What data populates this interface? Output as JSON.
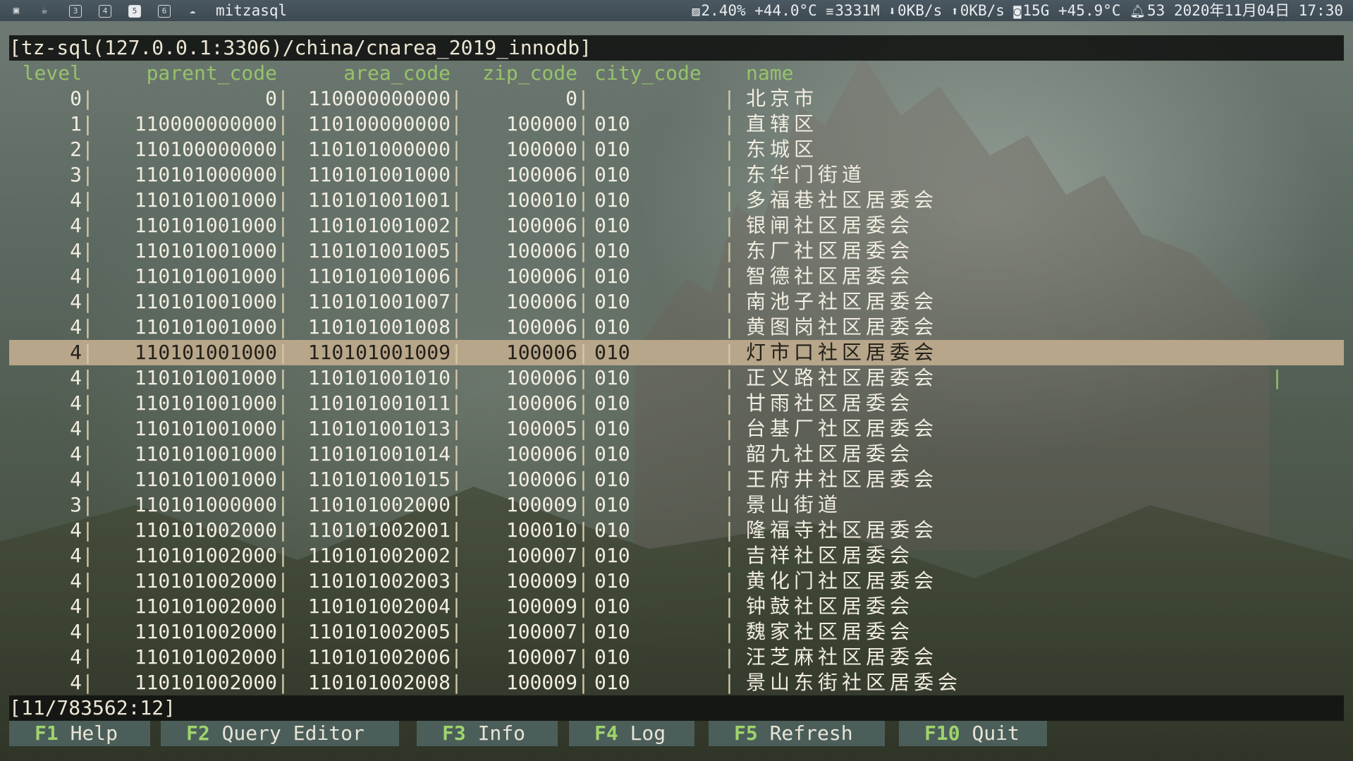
{
  "topbar": {
    "workspaces": [
      {
        "icon": "terminal-icon",
        "glyph": "▣"
      },
      {
        "icon": "coffee-icon",
        "glyph": "☕"
      },
      {
        "label": "3"
      },
      {
        "label": "4"
      },
      {
        "label": "5",
        "active": true
      },
      {
        "label": "6"
      },
      {
        "icon": "cloud-icon",
        "glyph": "☁"
      }
    ],
    "window_title": "mitzasql",
    "cpu": "2.40% +44.0°C",
    "mem": "3331M",
    "net_down": "0KB/s",
    "net_up": "0KB/s",
    "disk": "15G +45.9°C",
    "notifications": "53",
    "datetime": "2020年11月04日 17:30"
  },
  "terminal": {
    "title": "[tz-sql(127.0.0.1:3306)/china/cnarea_2019_innodb]",
    "columns": [
      "level",
      "parent_code",
      "area_code",
      "zip_code",
      "city_code",
      "name"
    ],
    "rows": [
      [
        "0",
        "0",
        "110000000000",
        "0",
        "",
        "北京市"
      ],
      [
        "1",
        "110000000000",
        "110100000000",
        "100000",
        "010",
        "直辖区"
      ],
      [
        "2",
        "110100000000",
        "110101000000",
        "100000",
        "010",
        "东城区"
      ],
      [
        "3",
        "110101000000",
        "110101001000",
        "100006",
        "010",
        "东华门街道"
      ],
      [
        "4",
        "110101001000",
        "110101001001",
        "100010",
        "010",
        "多福巷社区居委会"
      ],
      [
        "4",
        "110101001000",
        "110101001002",
        "100006",
        "010",
        "银闸社区居委会"
      ],
      [
        "4",
        "110101001000",
        "110101001005",
        "100006",
        "010",
        "东厂社区居委会"
      ],
      [
        "4",
        "110101001000",
        "110101001006",
        "100006",
        "010",
        "智德社区居委会"
      ],
      [
        "4",
        "110101001000",
        "110101001007",
        "100006",
        "010",
        "南池子社区居委会"
      ],
      [
        "4",
        "110101001000",
        "110101001008",
        "100006",
        "010",
        "黄图岗社区居委会"
      ],
      [
        "4",
        "110101001000",
        "110101001009",
        "100006",
        "010",
        "灯市口社区居委会"
      ],
      [
        "4",
        "110101001000",
        "110101001010",
        "100006",
        "010",
        "正义路社区居委会"
      ],
      [
        "4",
        "110101001000",
        "110101001011",
        "100006",
        "010",
        "甘雨社区居委会"
      ],
      [
        "4",
        "110101001000",
        "110101001013",
        "100005",
        "010",
        "台基厂社区居委会"
      ],
      [
        "4",
        "110101001000",
        "110101001014",
        "100006",
        "010",
        "韶九社区居委会"
      ],
      [
        "4",
        "110101001000",
        "110101001015",
        "100006",
        "010",
        "王府井社区居委会"
      ],
      [
        "3",
        "110101000000",
        "110101002000",
        "100009",
        "010",
        "景山街道"
      ],
      [
        "4",
        "110101002000",
        "110101002001",
        "100010",
        "010",
        "隆福寺社区居委会"
      ],
      [
        "4",
        "110101002000",
        "110101002002",
        "100007",
        "010",
        "吉祥社区居委会"
      ],
      [
        "4",
        "110101002000",
        "110101002003",
        "100009",
        "010",
        "黄化门社区居委会"
      ],
      [
        "4",
        "110101002000",
        "110101002004",
        "100009",
        "010",
        "钟鼓社区居委会"
      ],
      [
        "4",
        "110101002000",
        "110101002005",
        "100007",
        "010",
        "魏家社区居委会"
      ],
      [
        "4",
        "110101002000",
        "110101002006",
        "100007",
        "010",
        "汪芝麻社区居委会"
      ],
      [
        "4",
        "110101002000",
        "110101002008",
        "100009",
        "010",
        "景山东街社区居委会"
      ]
    ],
    "selected_row": 10,
    "position": "[11/783562:12]"
  },
  "fkeys": [
    {
      "key": "F1",
      "label": "Help"
    },
    {
      "key": "F2",
      "label": "Query Editor"
    },
    {
      "key": "F3",
      "label": "Info"
    },
    {
      "key": "F4",
      "label": "Log"
    },
    {
      "key": "F5",
      "label": "Refresh"
    },
    {
      "key": "F10",
      "label": "Quit"
    }
  ],
  "colors": {
    "selected_row": "#b7a68a",
    "header": "#97c26b",
    "fkey_bar": "#4b5e5a",
    "fkey_key": "#9fd46c"
  }
}
